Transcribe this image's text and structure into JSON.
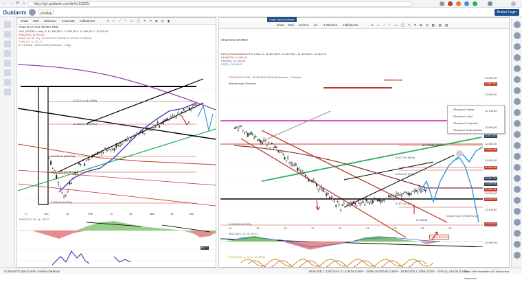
{
  "browser": {
    "url": "https://go.guidants.com/de#c/125221",
    "tab_title": "Desktop"
  },
  "app": {
    "logo": "Guidants",
    "login_label": "Broker Login"
  },
  "left_panel": {
    "toolbar": [
      "Chart",
      "Merl",
      "Zeitraum",
      "5 Monate",
      "Indikatoren"
    ],
    "title": "Chart DAX TAG XETRA PRE",
    "legend": [
      {
        "text": "DAX (XETRA, Last): O: 11.436,52  H: 11.502,30  L: 11.462,63  C: 11.419,04",
        "color": "#333333"
      },
      {
        "text": "EMA(200): 11.594,52",
        "color": "#c0392b"
      },
      {
        "text": "MA(3, 20, 50, 25): 11.461,28  11.551,50  11.377,54  11.553,54",
        "color": "#8e44ad"
      },
      {
        "text": "PMA(20): 11.152,97",
        "color": "#e67e22"
      },
      {
        "text": "27.12.2018 - 23.04.2019 (5 Monate, 1 Tag)",
        "color": "#555555"
      }
    ],
    "x_labels": [
      "17",
      "Jan",
      "16",
      "Feb",
      "11",
      "25",
      "Mär",
      "18",
      "Apr"
    ],
    "annotations": [
      "11.523,14 (61,80%)",
      "11.184,60 (50,00%)",
      "10.873,50 (38,20%)",
      "10.279,25 (23,60%)",
      "9.628,20 (0,00%)"
    ],
    "macd_label": "MACD(12, 26, 9): -65,70",
    "rsi_value": "68,77"
  },
  "right_panel": {
    "header_tab": "Chart Dax 60 Minute",
    "toolbar": [
      "Chart",
      "Merl",
      "Kerzen",
      "1h",
      "3 Wochen",
      "Indikatoren"
    ],
    "title": "Chart DAX 60 PRO",
    "legend": [
      {
        "text": "DAX (Commerzbank CFD, Last): O: 11.402,46  H: 11.407,56  L: 11.413,54  C: 11.416,15",
        "color": "#333333"
      },
      {
        "text": "EMA(200): 11.484,60",
        "color": "#c0392b"
      },
      {
        "text": "EMA(50): 11.382,45",
        "color": "#8e44ad"
      },
      {
        "text": "PP(D): 11.398,21",
        "color": "#2980b9"
      },
      {
        "text": "15.03.2019 13:00 - 26.03.2019 16:00 (3 Wochen, 1 Stunde)",
        "color": "#555555"
      }
    ],
    "dropdown_header": "Markierungs Fibonacci",
    "dropdown": [
      "Fibonacci Fächer",
      "Fibonacci Level",
      "Fibonacci Projection",
      "Fibonacci Zeitprojektion"
    ],
    "resistance_label": "WIDERSTAND",
    "price_axis": [
      "11.900,00",
      "11.800,00",
      "11.700,00",
      "11.600,00",
      "11.500,00",
      "11.400,00",
      "11.300,00",
      "11.200,00",
      "11.100,00",
      "11.000,00",
      "10.900,00"
    ],
    "annotations": [
      "11.645,56 (38%)",
      "11.577,60 (50%)",
      "11.542,32 (61%)",
      "11.371,34 (%)",
      "11.298,84",
      "11.010,58 (0,00%)",
      "GDLA BLOCK",
      "Kursziel DAX (EINDRUCK)"
    ],
    "tags": [
      {
        "text": "11.887,50",
        "color": "#c0392b"
      },
      {
        "text": "11.672,00",
        "color": "#2c3e50"
      },
      {
        "text": "11.644,26",
        "color": "#c0392b"
      },
      {
        "text": "11.590,62",
        "color": "#c0392b"
      },
      {
        "text": "11.427,70",
        "color": "#2c3e50"
      },
      {
        "text": "11.419,04",
        "color": "#2c3e50"
      },
      {
        "text": "11.360,41",
        "color": "#c0392b"
      },
      {
        "text": "11.240,00",
        "color": "#c0392b"
      },
      {
        "text": "11.205,00",
        "color": "#c0392b"
      }
    ],
    "x_labels": [
      "14",
      "15",
      "18",
      "19",
      "20",
      "21",
      "22",
      "25",
      "26"
    ],
    "macd_label": "MACD(12, 26, 9): 35,01",
    "stoch_label": "STOCH(14, 3, 3): 67,60  58,61"
  },
  "status_bar": {
    "left": "GUIDANTS (bei Kombi: Stream-Desktop",
    "tickers": "EURUSD 1,1297  DAX 11.419,04  0,55%  ·  DOW 25.520,61  0,63%  ·  EUR/USD 1,1259  0,02%  ·  DAX 11.419,04  0,55%",
    "links": "Status  Hilfe  Newsletter  AGB  Datenschutz  Impressum"
  }
}
